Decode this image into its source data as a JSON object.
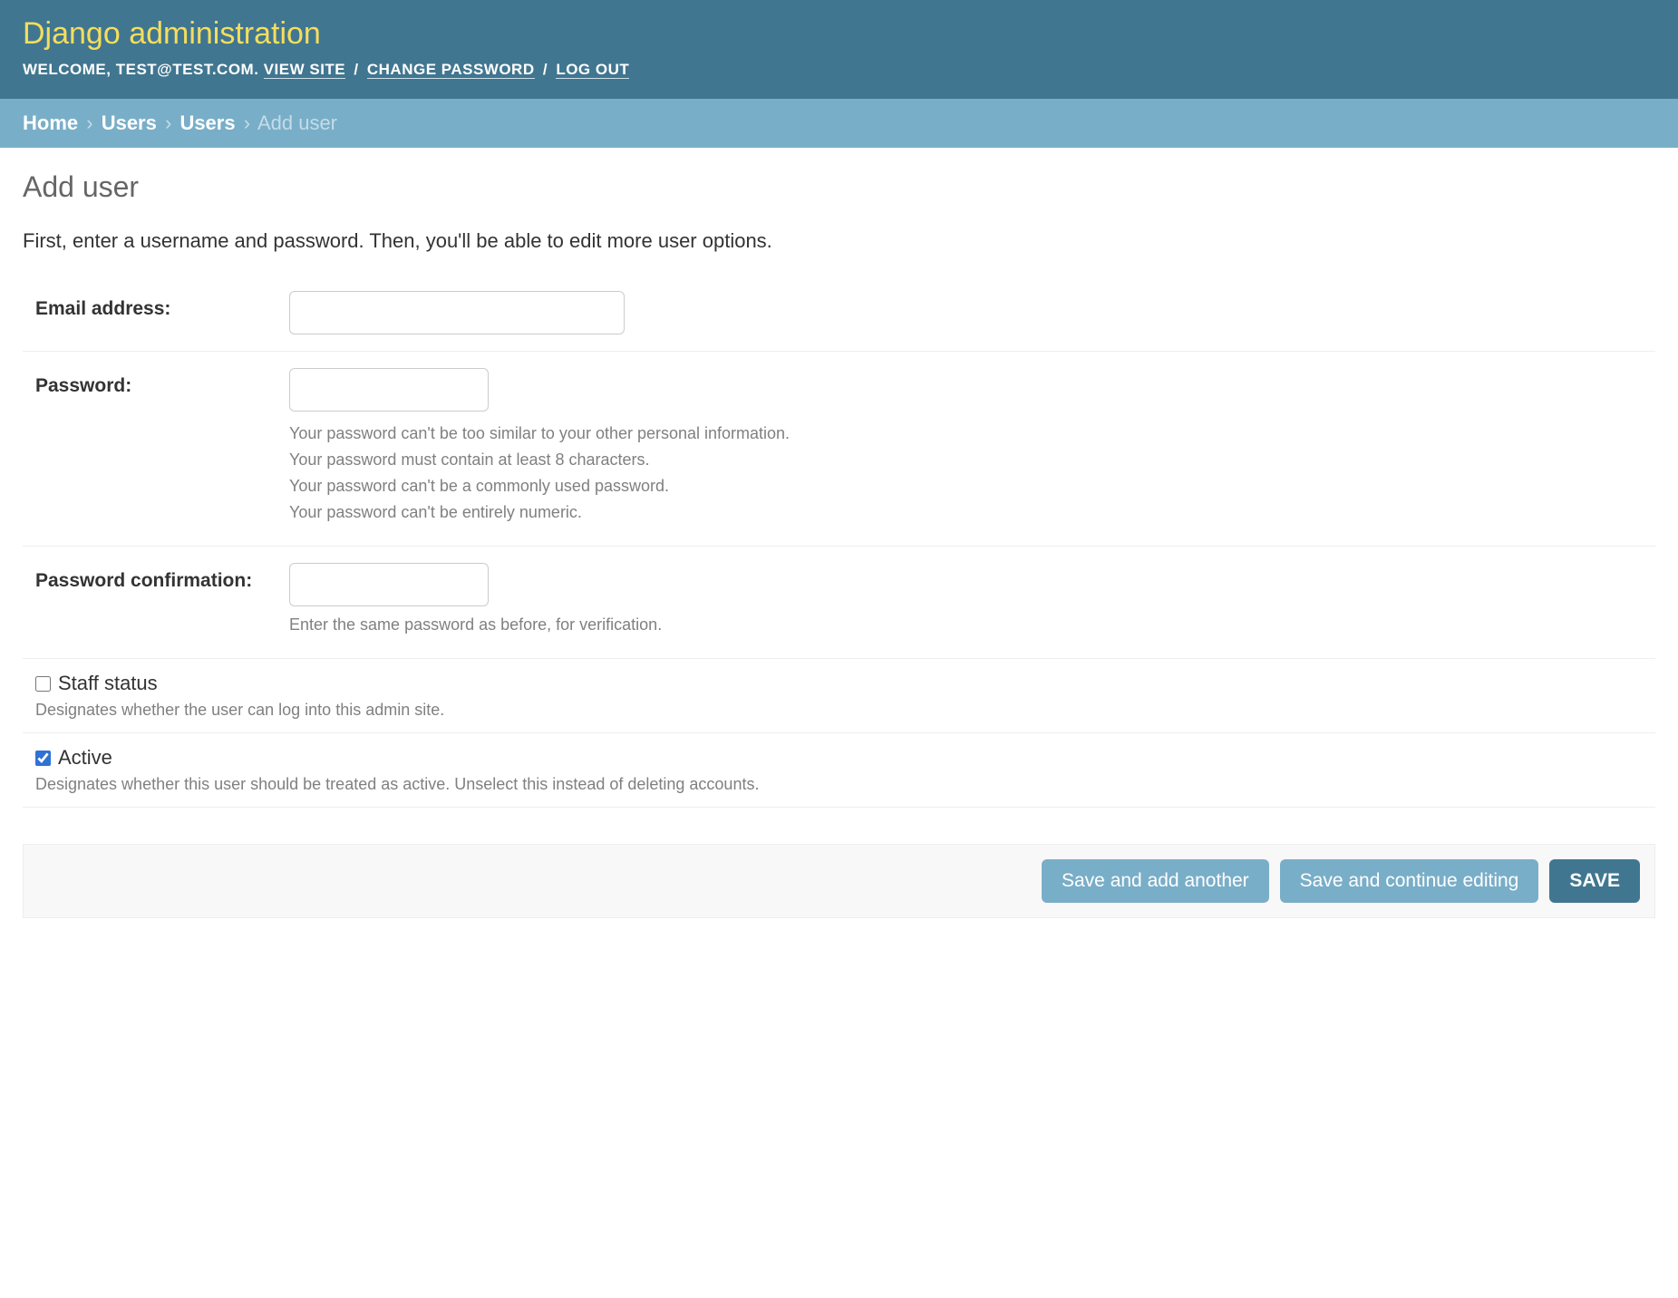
{
  "header": {
    "site_title": "Django administration",
    "welcome_label": "WELCOME,",
    "username": "TEST@TEST.COM",
    "dot": ".",
    "view_site": "VIEW SITE",
    "change_password": "CHANGE PASSWORD",
    "logout": "LOG OUT",
    "sep": "/"
  },
  "breadcrumbs": {
    "home": "Home",
    "app": "Users",
    "model": "Users",
    "current": "Add user",
    "sep": "›"
  },
  "page": {
    "title": "Add user",
    "intro": "First, enter a username and password. Then, you'll be able to edit more user options."
  },
  "form": {
    "email": {
      "label": "Email address:",
      "value": ""
    },
    "password": {
      "label": "Password:",
      "value": "",
      "help": [
        "Your password can't be too similar to your other personal information.",
        "Your password must contain at least 8 characters.",
        "Your password can't be a commonly used password.",
        "Your password can't be entirely numeric."
      ]
    },
    "password2": {
      "label": "Password confirmation:",
      "value": "",
      "help": "Enter the same password as before, for verification."
    },
    "staff": {
      "label": "Staff status",
      "checked": false,
      "help": "Designates whether the user can log into this admin site."
    },
    "active": {
      "label": "Active",
      "checked": true,
      "help": "Designates whether this user should be treated as active. Unselect this instead of deleting accounts."
    }
  },
  "buttons": {
    "save_add_another": "Save and add another",
    "save_continue": "Save and continue editing",
    "save": "SAVE"
  }
}
